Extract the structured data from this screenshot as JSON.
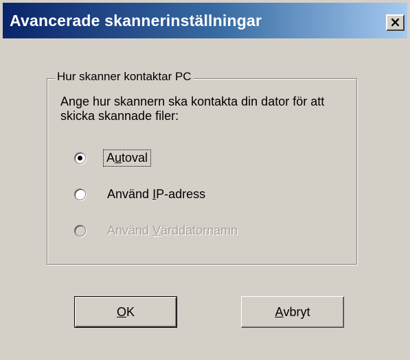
{
  "dialog": {
    "title": "Avancerade skannerinställningar",
    "close_label": "×"
  },
  "group": {
    "legend": "Hur skanner kontaktar PC",
    "description": "Ange hur skannern ska kontakta din dator för att skicka skannade filer:",
    "options": [
      {
        "pre": "A",
        "accel": "u",
        "post": "toval",
        "checked": true,
        "enabled": true
      },
      {
        "pre": "Använd ",
        "accel": "I",
        "post": "P-adress",
        "checked": false,
        "enabled": true
      },
      {
        "pre": "Använd ",
        "accel": "V",
        "post": "ärddatornamn",
        "checked": false,
        "enabled": false
      }
    ]
  },
  "buttons": {
    "ok": {
      "accel": "O",
      "post": "K"
    },
    "cancel": {
      "accel": "A",
      "post": "vbryt"
    }
  }
}
